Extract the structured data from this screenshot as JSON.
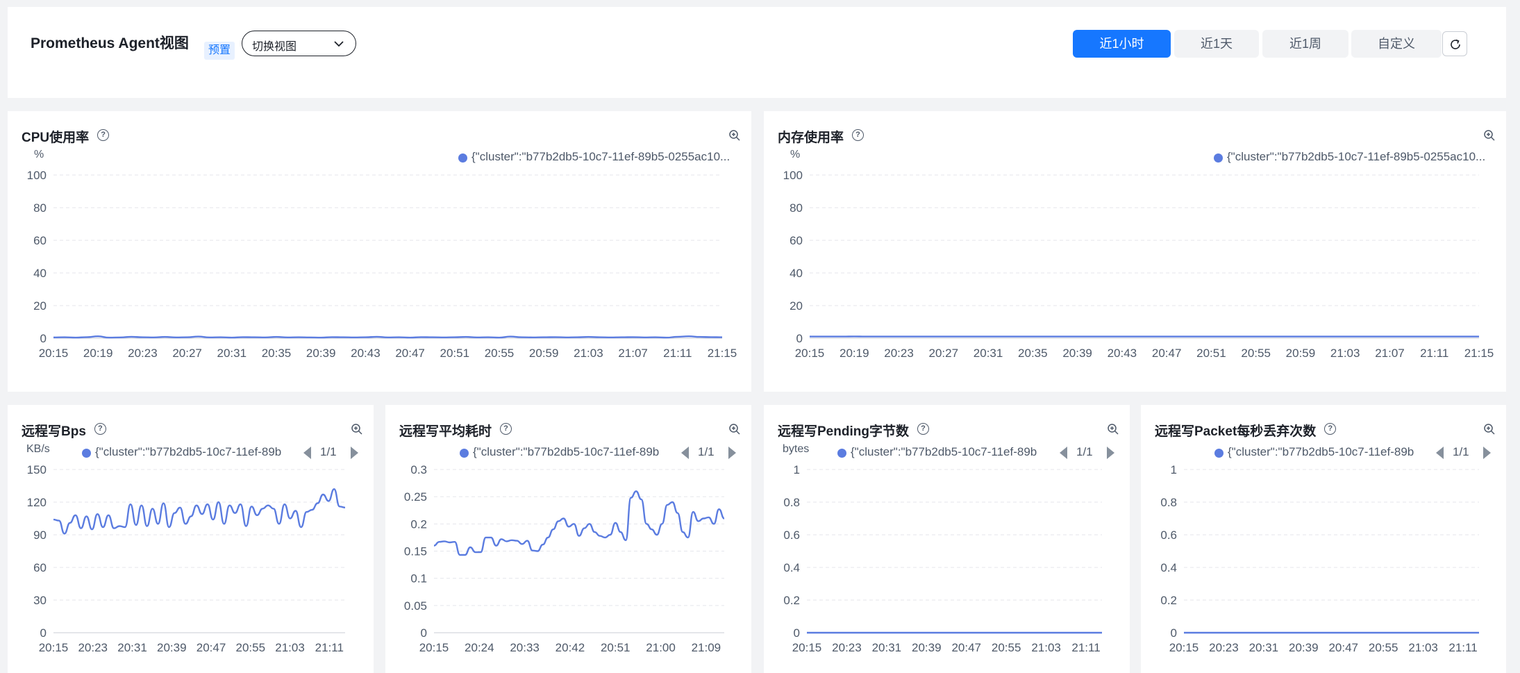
{
  "header": {
    "title": "Prometheus Agent视图",
    "preset_tag": "预置",
    "view_select": "切换视图",
    "time_ranges": [
      "近1小时",
      "近1天",
      "近1周",
      "自定义"
    ],
    "active_time_range": "近1小时"
  },
  "series_color": "#5b7ce0",
  "accent_color": "#1677ff",
  "panels": [
    {
      "title": "CPU使用率",
      "unit": "%",
      "legend": "{\"cluster\":\"b77b2db5-10c7-11ef-89b5-0255ac10...",
      "pager": ""
    },
    {
      "title": "内存使用率",
      "unit": "%",
      "legend": "{\"cluster\":\"b77b2db5-10c7-11ef-89b5-0255ac10...",
      "pager": ""
    },
    {
      "title": "远程写Bps",
      "unit": "KB/s",
      "legend": "{\"cluster\":\"b77b2db5-10c7-11ef-89b",
      "pager": "1/1"
    },
    {
      "title": "远程写平均耗时",
      "unit": "",
      "legend": "{\"cluster\":\"b77b2db5-10c7-11ef-89b",
      "pager": "1/1"
    },
    {
      "title": "远程写Pending字节数",
      "unit": "bytes",
      "legend": "{\"cluster\":\"b77b2db5-10c7-11ef-89b",
      "pager": "1/1"
    },
    {
      "title": "远程写Packet每秒丢弃次数",
      "unit": "",
      "legend": "{\"cluster\":\"b77b2db5-10c7-11ef-89b",
      "pager": "1/1"
    }
  ],
  "chart_data": [
    {
      "type": "line",
      "title": "CPU使用率",
      "ylabel": "%",
      "ylim": [
        0,
        100
      ],
      "yticks": [
        0,
        20,
        40,
        60,
        80,
        100
      ],
      "xticks": [
        "20:15",
        "20:19",
        "20:23",
        "20:27",
        "20:31",
        "20:35",
        "20:39",
        "20:43",
        "20:47",
        "20:51",
        "20:55",
        "20:59",
        "21:03",
        "21:07",
        "21:11",
        "21:15"
      ],
      "grid": true,
      "legend_position": "top-right",
      "series": [
        {
          "name": "{\"cluster\":\"b77b2db5-10c7-11ef-89b5-0255ac10...",
          "values": [
            0.5,
            0.6,
            0.4,
            0.7,
            1.2,
            0.4,
            0.5,
            0.9,
            0.6,
            0.5,
            0.8,
            0.5,
            0.6,
            1.0,
            0.5,
            0.6,
            0.4,
            0.7,
            0.6,
            0.5,
            0.8,
            0.5,
            0.6,
            0.5,
            0.4,
            0.7,
            0.6,
            0.5,
            0.6,
            0.9,
            0.5,
            0.6,
            0.4,
            0.7,
            0.6,
            0.5,
            0.6,
            0.8,
            0.5,
            0.6,
            0.4,
            1.0,
            0.6,
            0.5,
            0.6,
            0.7,
            0.5,
            0.6,
            0.8,
            0.6,
            0.5,
            0.6,
            0.7,
            0.5,
            0.6,
            0.4,
            0.9,
            1.2,
            0.8,
            0.7,
            0.6
          ]
        }
      ]
    },
    {
      "type": "line",
      "title": "内存使用率",
      "ylabel": "%",
      "ylim": [
        0,
        100
      ],
      "yticks": [
        0,
        20,
        40,
        60,
        80,
        100
      ],
      "xticks": [
        "20:15",
        "20:19",
        "20:23",
        "20:27",
        "20:31",
        "20:35",
        "20:39",
        "20:43",
        "20:47",
        "20:51",
        "20:55",
        "20:59",
        "21:03",
        "21:07",
        "21:11",
        "21:15"
      ],
      "grid": true,
      "legend_position": "top-right",
      "series": [
        {
          "name": "{\"cluster\":\"b77b2db5-10c7-11ef-89b5-0255ac10...",
          "values": [
            1.0,
            1.0,
            1.0,
            1.0,
            1.1,
            1.0,
            1.0,
            1.0,
            1.0,
            1.0,
            1.0,
            1.0,
            1.0,
            1.0,
            1.0,
            1.0,
            1.0,
            1.0,
            1.0,
            1.0,
            1.0,
            1.0,
            1.0,
            1.0,
            1.0,
            1.0,
            1.0,
            1.0,
            1.0,
            1.0,
            1.0,
            1.0,
            1.0,
            1.0,
            1.0,
            1.0,
            1.0,
            1.0,
            1.0,
            1.0,
            1.0,
            1.0,
            1.0,
            1.0,
            1.0,
            1.0,
            1.0,
            1.0,
            1.0,
            1.0,
            1.0,
            1.0,
            1.0,
            1.0,
            1.0,
            1.0,
            1.0,
            1.0,
            1.0,
            1.0,
            1.0
          ]
        }
      ]
    },
    {
      "type": "line",
      "title": "远程写Bps",
      "ylabel": "KB/s",
      "ylim": [
        0,
        150
      ],
      "yticks": [
        0,
        30,
        60,
        90,
        120,
        150
      ],
      "xticks": [
        "20:15",
        "20:23",
        "20:31",
        "20:39",
        "20:47",
        "20:55",
        "21:03",
        "21:11"
      ],
      "grid": true,
      "legend_position": "top",
      "series": [
        {
          "name": "{\"cluster\":\"b77b2db5-10c7-11ef-89b",
          "values": [
            104,
            103,
            91,
            101,
            108,
            96,
            107,
            95,
            109,
            97,
            108,
            96,
            98,
            97,
            118,
            99,
            117,
            98,
            114,
            100,
            119,
            97,
            110,
            115,
            100,
            107,
            117,
            109,
            118,
            104,
            120,
            100,
            117,
            110,
            118,
            98,
            116,
            108,
            114,
            117,
            114,
            100,
            118,
            105,
            112,
            97,
            111,
            113,
            119,
            127,
            121,
            132,
            116,
            115
          ]
        }
      ]
    },
    {
      "type": "line",
      "title": "远程写平均耗时",
      "ylim": [
        0,
        0.3
      ],
      "yticks": [
        0,
        0.05,
        0.1,
        0.15,
        0.2,
        0.25,
        0.3
      ],
      "xticks": [
        "20:15",
        "20:24",
        "20:33",
        "20:42",
        "20:51",
        "21:00",
        "21:09"
      ],
      "grid": true,
      "legend_position": "top",
      "series": [
        {
          "name": "{\"cluster\":\"b77b2db5-10c7-11ef-89b",
          "values": [
            0.16,
            0.167,
            0.168,
            0.166,
            0.167,
            0.143,
            0.143,
            0.157,
            0.148,
            0.148,
            0.175,
            0.175,
            0.16,
            0.172,
            0.168,
            0.17,
            0.169,
            0.163,
            0.169,
            0.151,
            0.15,
            0.162,
            0.175,
            0.19,
            0.205,
            0.21,
            0.195,
            0.2,
            0.178,
            0.192,
            0.2,
            0.185,
            0.178,
            0.175,
            0.18,
            0.202,
            0.185,
            0.17,
            0.248,
            0.26,
            0.245,
            0.2,
            0.19,
            0.18,
            0.2,
            0.235,
            0.24,
            0.22,
            0.185,
            0.175,
            0.222,
            0.205,
            0.21,
            0.212,
            0.2,
            0.227,
            0.21
          ]
        }
      ]
    },
    {
      "type": "line",
      "title": "远程写Pending字节数",
      "ylabel": "bytes",
      "ylim": [
        0,
        1
      ],
      "yticks": [
        0,
        0.2,
        0.4,
        0.6,
        0.8,
        1
      ],
      "xticks": [
        "20:15",
        "20:23",
        "20:31",
        "20:39",
        "20:47",
        "20:55",
        "21:03",
        "21:11"
      ],
      "grid": true,
      "legend_position": "top",
      "series": [
        {
          "name": "{\"cluster\":\"b77b2db5-10c7-11ef-89b",
          "values": [
            0,
            0,
            0,
            0,
            0,
            0,
            0,
            0,
            0,
            0,
            0,
            0,
            0,
            0,
            0,
            0,
            0,
            0,
            0,
            0,
            0,
            0,
            0,
            0,
            0,
            0,
            0,
            0,
            0,
            0,
            0,
            0,
            0,
            0,
            0,
            0,
            0,
            0,
            0,
            0,
            0,
            0,
            0,
            0,
            0,
            0,
            0,
            0,
            0,
            0,
            0,
            0,
            0,
            0,
            0,
            0,
            0,
            0,
            0,
            0,
            0
          ]
        }
      ]
    },
    {
      "type": "line",
      "title": "远程写Packet每秒丢弃次数",
      "ylim": [
        0,
        1
      ],
      "yticks": [
        0,
        0.2,
        0.4,
        0.6,
        0.8,
        1
      ],
      "xticks": [
        "20:15",
        "20:23",
        "20:31",
        "20:39",
        "20:47",
        "20:55",
        "21:03",
        "21:11"
      ],
      "grid": true,
      "legend_position": "top",
      "series": [
        {
          "name": "{\"cluster\":\"b77b2db5-10c7-11ef-89b",
          "values": [
            0,
            0,
            0,
            0,
            0,
            0,
            0,
            0,
            0,
            0,
            0,
            0,
            0,
            0,
            0,
            0,
            0,
            0,
            0,
            0,
            0,
            0,
            0,
            0,
            0,
            0,
            0,
            0,
            0,
            0,
            0,
            0,
            0,
            0,
            0,
            0,
            0,
            0,
            0,
            0,
            0,
            0,
            0,
            0,
            0,
            0,
            0,
            0,
            0,
            0,
            0,
            0,
            0,
            0,
            0,
            0,
            0,
            0,
            0,
            0,
            0
          ]
        }
      ]
    }
  ]
}
